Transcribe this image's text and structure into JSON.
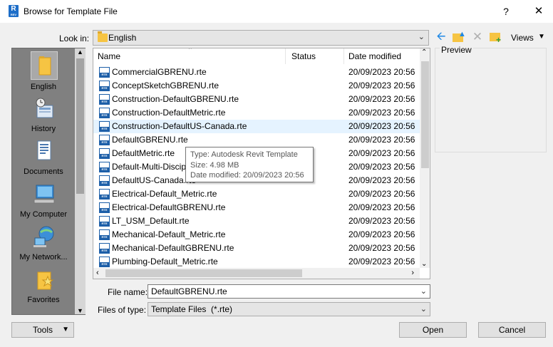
{
  "window": {
    "title": "Browse for Template File",
    "help": "?",
    "close": "✕",
    "app_icon": {
      "letter": "R",
      "sub": "REV"
    }
  },
  "toolbar": {
    "look_in_label": "Look in:",
    "look_in_value": "English",
    "views_label": "Views"
  },
  "places": [
    {
      "label": "English",
      "icon": "folder-icon",
      "selected": true
    },
    {
      "label": "History",
      "icon": "history-icon"
    },
    {
      "label": "Documents",
      "icon": "documents-icon"
    },
    {
      "label": "My Computer",
      "icon": "computer-icon"
    },
    {
      "label": "My Network...",
      "icon": "network-icon"
    },
    {
      "label": "Favorites",
      "icon": "favorites-icon"
    }
  ],
  "columns": {
    "name": "Name",
    "status": "Status",
    "date_modified": "Date modified"
  },
  "files": [
    {
      "name": "CommercialGBRENU.rte",
      "date": "20/09/2023 20:56"
    },
    {
      "name": "ConceptSketchGBRENU.rte",
      "date": "20/09/2023 20:56"
    },
    {
      "name": "Construction-DefaultGBRENU.rte",
      "date": "20/09/2023 20:56"
    },
    {
      "name": "Construction-DefaultMetric.rte",
      "date": "20/09/2023 20:56"
    },
    {
      "name": "Construction-DefaultUS-Canada.rte",
      "date": "20/09/2023 20:56"
    },
    {
      "name": "DefaultGBRENU.rte",
      "date": "20/09/2023 20:56"
    },
    {
      "name": "DefaultMetric.rte",
      "date": "20/09/2023 20:56"
    },
    {
      "name": "Default-Multi-Discip",
      "date": "20/09/2023 20:56"
    },
    {
      "name": "DefaultUS-Canada.rte",
      "date": "20/09/2023 20:56"
    },
    {
      "name": "Electrical-Default_Metric.rte",
      "date": "20/09/2023 20:56"
    },
    {
      "name": "Electrical-DefaultGBRENU.rte",
      "date": "20/09/2023 20:56"
    },
    {
      "name": "LT_USM_Default.rte",
      "date": "20/09/2023 20:56"
    },
    {
      "name": "Mechanical-Default_Metric.rte",
      "date": "20/09/2023 20:56"
    },
    {
      "name": "Mechanical-DefaultGBRENU.rte",
      "date": "20/09/2023 20:56"
    },
    {
      "name": "Plumbing-Default_Metric.rte",
      "date": "20/09/2023 20:56"
    }
  ],
  "tooltip": {
    "type": "Type: Autodesk Revit Template",
    "size": "Size: 4.98 MB",
    "date": "Date modified: 20/09/2023 20:56"
  },
  "preview": {
    "label": "Preview"
  },
  "form": {
    "file_name_label": "File name:",
    "file_name_value": "DefaultGBRENU.rte",
    "file_type_label": "Files of type:",
    "file_type_value": "Template Files  (*.rte)"
  },
  "buttons": {
    "tools": "Tools",
    "open": "Open",
    "cancel": "Cancel"
  }
}
